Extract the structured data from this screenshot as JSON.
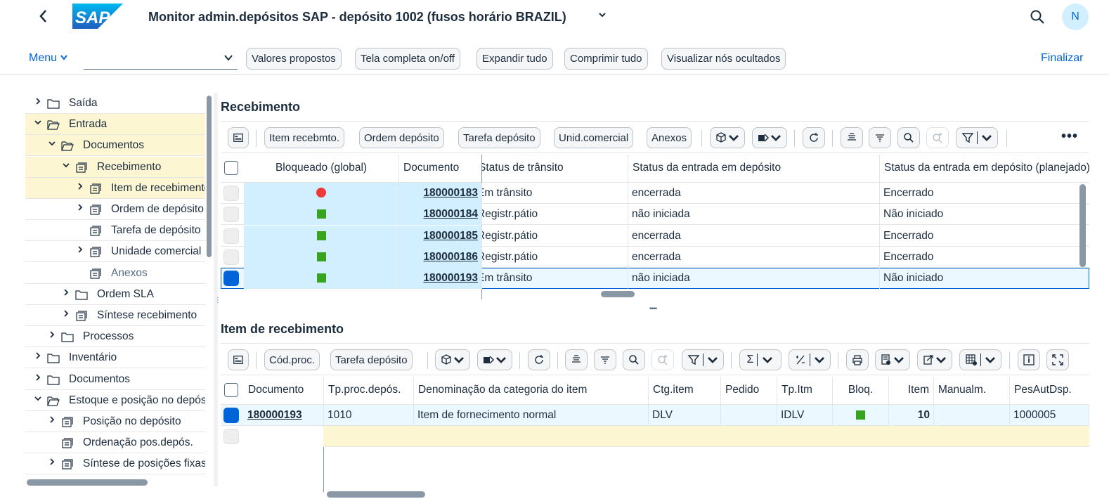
{
  "shell": {
    "title": "Monitor admin.depósitos SAP - depósito 1002 (fusos horário BRAZIL)",
    "logo_text": "SAP",
    "avatar_initial": "N",
    "brand_color": "#0064d9"
  },
  "toolbar": {
    "menu_label": "Menu",
    "command_field_value": "",
    "buttons": [
      "Valores propostos",
      "Tela completa on/off",
      "Expandir tudo",
      "Comprimir tudo",
      "Visualizar nós ocultados"
    ],
    "finalize_label": "Finalizar"
  },
  "tree": {
    "items": [
      {
        "label": "Saída",
        "expander": "collapsed",
        "icon": "folder-icon"
      },
      {
        "label": "Entrada",
        "expander": "expanded",
        "icon": "open-folder-icon",
        "selected": true
      },
      {
        "label": "Documentos",
        "expander": "expanded",
        "icon": "open-folder-icon",
        "selected": true
      },
      {
        "label": "Recebimento",
        "expander": "expanded",
        "icon": "document-stack-icon",
        "selected": true
      },
      {
        "label": "Item de recebimento",
        "expander": "collapsed",
        "icon": "document-stack-icon",
        "selected": true
      },
      {
        "label": "Ordem de depósito",
        "expander": "collapsed",
        "icon": "document-stack-icon"
      },
      {
        "label": "Tarefa de depósito",
        "expander": "none",
        "icon": "document-stack-icon"
      },
      {
        "label": "Unidade comercial",
        "expander": "collapsed",
        "icon": "document-stack-icon"
      },
      {
        "label": "Anexos",
        "expander": "none",
        "icon": "document-stack-icon",
        "dim": true
      },
      {
        "label": "Ordem SLA",
        "expander": "collapsed",
        "icon": "folder-icon"
      },
      {
        "label": "Síntese recebimento",
        "expander": "collapsed",
        "icon": "document-stack-icon"
      },
      {
        "label": "Processos",
        "expander": "collapsed",
        "icon": "folder-icon"
      },
      {
        "label": "Inventário",
        "expander": "collapsed",
        "icon": "folder-icon"
      },
      {
        "label": "Documentos",
        "expander": "collapsed",
        "icon": "folder-icon"
      },
      {
        "label": "Estoque e posição no depósito",
        "expander": "expanded",
        "icon": "open-folder-icon"
      },
      {
        "label": "Posição no depósito",
        "expander": "collapsed",
        "icon": "document-stack-icon"
      },
      {
        "label": "Ordenação pos.depós.",
        "expander": "none",
        "icon": "document-stack-icon"
      },
      {
        "label": "Síntese de posições fixas",
        "expander": "collapsed",
        "icon": "document-stack-icon"
      }
    ]
  },
  "recebimento": {
    "title": "Recebimento",
    "toolbar_buttons": [
      "Item recebmto.",
      "Ordem depósito",
      "Tarefa depósito",
      "Unid.comercial",
      "Anexos"
    ],
    "columns": [
      "Bloqueado (global)",
      "Documento",
      "Status de trânsito",
      "Status da entrada em depósito",
      "Status da entrada em depósito (planejado)"
    ],
    "rows": [
      {
        "blocked": "red",
        "documento": "180000183",
        "transito": "Em trânsito",
        "entrada": "encerrada",
        "planejado": "Encerrado",
        "selected": false
      },
      {
        "blocked": "green",
        "documento": "180000184",
        "transito": "Registr.pátio",
        "entrada": "não iniciada",
        "planejado": "Não iniciado",
        "selected": false
      },
      {
        "blocked": "green",
        "documento": "180000185",
        "transito": "Registr.pátio",
        "entrada": "encerrada",
        "planejado": "Encerrado",
        "selected": false
      },
      {
        "blocked": "green",
        "documento": "180000186",
        "transito": "Registr.pátio",
        "entrada": "encerrada",
        "planejado": "Encerrado",
        "selected": false
      },
      {
        "blocked": "green",
        "documento": "180000193",
        "transito": "Em trânsito",
        "entrada": "não iniciada",
        "planejado": "Não iniciado",
        "selected": true
      }
    ]
  },
  "item": {
    "title": "Item de recebimento",
    "toolbar_buttons": [
      "Cód.proc.",
      "Tarefa depósito"
    ],
    "columns": [
      "Documento",
      "Tp.proc.depós.",
      "Denominação da categoria do item",
      "Ctg.item",
      "Pedido",
      "Tp.Itm",
      "Bloq.",
      "Item",
      "Manualm.",
      "PesAutDsp."
    ],
    "rows": [
      {
        "documento": "180000193",
        "tpproc": "1010",
        "denominacao": "Item de fornecimento normal",
        "ctgitem": "DLV",
        "pedido": "",
        "tpitm": "IDLV",
        "bloq": "green",
        "item": "10",
        "manualm": "",
        "pesaut": "1000005",
        "selected": true
      }
    ]
  },
  "colors": {
    "selection_blue": "#d1efff",
    "tree_selected": "#fdf6d2",
    "status_red": "#ee3939",
    "status_green": "#36a41d"
  }
}
